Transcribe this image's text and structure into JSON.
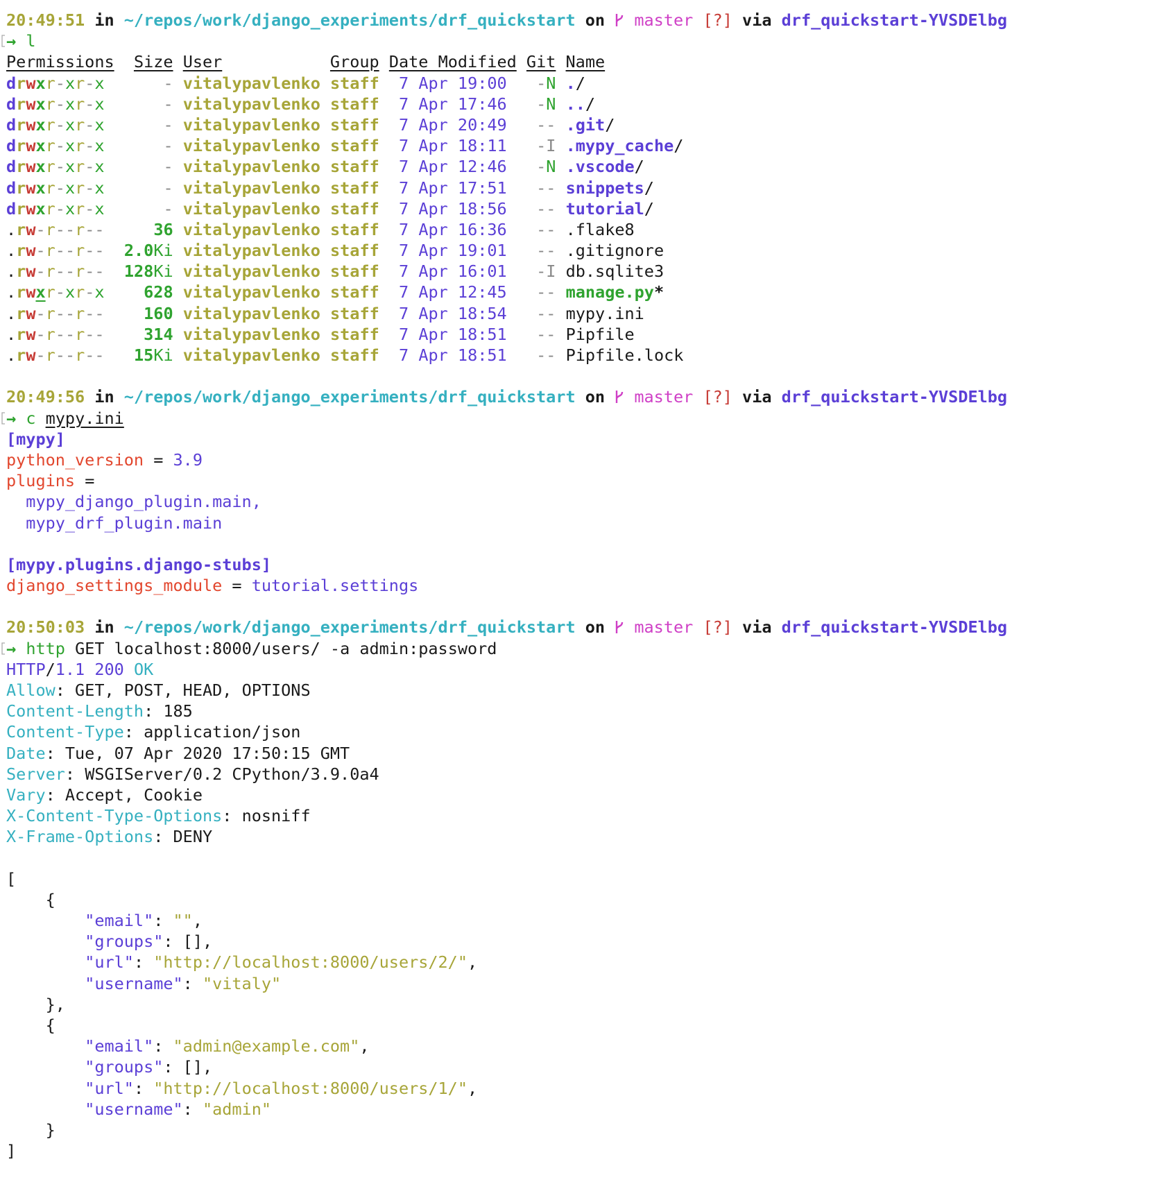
{
  "prompts": [
    {
      "time": "20:49:51",
      "in": "in",
      "path": "~/repos/work/django_experiments/drf_quickstart",
      "on": "on",
      "branch": "master",
      "status": "[?]",
      "via": "via",
      "venv": "drf_quickstart-YVSDElbg",
      "cmd": "l",
      "args": ""
    },
    {
      "time": "20:49:56",
      "in": "in",
      "path": "~/repos/work/django_experiments/drf_quickstart",
      "on": "on",
      "branch": "master",
      "status": "[?]",
      "via": "via",
      "venv": "drf_quickstart-YVSDElbg",
      "cmd": "c",
      "args": "mypy.ini"
    },
    {
      "time": "20:50:03",
      "in": "in",
      "path": "~/repos/work/django_experiments/drf_quickstart",
      "on": "on",
      "branch": "master",
      "status": "[?]",
      "via": "via",
      "venv": "drf_quickstart-YVSDElbg",
      "cmd": "http",
      "args": "GET localhost:8000/users/ -a admin:password"
    }
  ],
  "listing": {
    "headers": {
      "permissions": "Permissions",
      "size": "Size",
      "user": "User",
      "group": "Group",
      "date": "Date Modified",
      "git": "Git",
      "name": "Name"
    },
    "rows": [
      {
        "type": "d",
        "perm": "rwx",
        "rest": "r-xr-x",
        "size": "-",
        "user": "vitalypavlenko",
        "group": "staff",
        "date": "7 Apr 19:00",
        "git": "-N",
        "name": "./",
        "kind": "dir"
      },
      {
        "type": "d",
        "perm": "rwx",
        "rest": "r-xr-x",
        "size": "-",
        "user": "vitalypavlenko",
        "group": "staff",
        "date": "7 Apr 17:46",
        "git": "-N",
        "name": "../",
        "kind": "dir"
      },
      {
        "type": "d",
        "perm": "rwx",
        "rest": "r-xr-x",
        "size": "-",
        "user": "vitalypavlenko",
        "group": "staff",
        "date": "7 Apr 20:49",
        "git": "--",
        "name": ".git/",
        "kind": "dir"
      },
      {
        "type": "d",
        "perm": "rwx",
        "rest": "r-xr-x",
        "size": "-",
        "user": "vitalypavlenko",
        "group": "staff",
        "date": "7 Apr 18:11",
        "git": "-I",
        "name": ".mypy_cache/",
        "kind": "dir"
      },
      {
        "type": "d",
        "perm": "rwx",
        "rest": "r-xr-x",
        "size": "-",
        "user": "vitalypavlenko",
        "group": "staff",
        "date": "7 Apr 12:46",
        "git": "-N",
        "name": ".vscode/",
        "kind": "dir"
      },
      {
        "type": "d",
        "perm": "rwx",
        "rest": "r-xr-x",
        "size": "-",
        "user": "vitalypavlenko",
        "group": "staff",
        "date": "7 Apr 17:51",
        "git": "--",
        "name": "snippets/",
        "kind": "dir"
      },
      {
        "type": "d",
        "perm": "rwx",
        "rest": "r-xr-x",
        "size": "-",
        "user": "vitalypavlenko",
        "group": "staff",
        "date": "7 Apr 18:56",
        "git": "--",
        "name": "tutorial/",
        "kind": "dir"
      },
      {
        "type": ".",
        "perm": "rw-",
        "rest": "r--r--",
        "size": "36",
        "user": "vitalypavlenko",
        "group": "staff",
        "date": "7 Apr 16:36",
        "git": "--",
        "name": ".flake8",
        "kind": "file"
      },
      {
        "type": ".",
        "perm": "rw-",
        "rest": "r--r--",
        "size": "2.0Ki",
        "user": "vitalypavlenko",
        "group": "staff",
        "date": "7 Apr 19:01",
        "git": "--",
        "name": ".gitignore",
        "kind": "file"
      },
      {
        "type": ".",
        "perm": "rw-",
        "rest": "r--r--",
        "size": "128Ki",
        "user": "vitalypavlenko",
        "group": "staff",
        "date": "7 Apr 16:01",
        "git": "-I",
        "name": "db.sqlite3",
        "kind": "file"
      },
      {
        "type": ".",
        "perm": "rwx",
        "rest": "r-xr-x",
        "size": "628",
        "user": "vitalypavlenko",
        "group": "staff",
        "date": "7 Apr 12:45",
        "git": "--",
        "name": "manage.py*",
        "kind": "exec"
      },
      {
        "type": ".",
        "perm": "rw-",
        "rest": "r--r--",
        "size": "160",
        "user": "vitalypavlenko",
        "group": "staff",
        "date": "7 Apr 18:54",
        "git": "--",
        "name": "mypy.ini",
        "kind": "file"
      },
      {
        "type": ".",
        "perm": "rw-",
        "rest": "r--r--",
        "size": "314",
        "user": "vitalypavlenko",
        "group": "staff",
        "date": "7 Apr 18:51",
        "git": "--",
        "name": "Pipfile",
        "kind": "file"
      },
      {
        "type": ".",
        "perm": "rw-",
        "rest": "r--r--",
        "size": "15Ki",
        "user": "vitalypavlenko",
        "group": "staff",
        "date": "7 Apr 18:51",
        "git": "--",
        "name": "Pipfile.lock",
        "kind": "file"
      }
    ]
  },
  "ini": {
    "lines": [
      {
        "kind": "section",
        "text": "[mypy]"
      },
      {
        "kind": "kv",
        "key": "python_version",
        "eq": " = ",
        "value": "3.9"
      },
      {
        "kind": "kv",
        "key": "plugins",
        "eq": " =",
        "value": ""
      },
      {
        "kind": "cont",
        "text": "  mypy_django_plugin.main,"
      },
      {
        "kind": "cont",
        "text": "  mypy_drf_plugin.main"
      },
      {
        "kind": "blank"
      },
      {
        "kind": "section",
        "text": "[mypy.plugins.django-stubs]"
      },
      {
        "kind": "kv",
        "key": "django_settings_module",
        "eq": " = ",
        "value": "tutorial.settings"
      }
    ]
  },
  "http": {
    "status": {
      "proto": "HTTP",
      "slash": "/",
      "version": "1.1",
      "code": "200",
      "reason": "OK"
    },
    "headers": [
      {
        "name": "Allow",
        "value": "GET, POST, HEAD, OPTIONS"
      },
      {
        "name": "Content-Length",
        "value": "185"
      },
      {
        "name": "Content-Type",
        "value": "application/json"
      },
      {
        "name": "Date",
        "value": "Tue, 07 Apr 2020 17:50:15 GMT"
      },
      {
        "name": "Server",
        "value": "WSGIServer/0.2 CPython/3.9.0a4"
      },
      {
        "name": "Vary",
        "value": "Accept, Cookie"
      },
      {
        "name": "X-Content-Type-Options",
        "value": "nosniff"
      },
      {
        "name": "X-Frame-Options",
        "value": "DENY"
      }
    ],
    "body": [
      {
        "email": "\"\"",
        "groups": "[]",
        "url": "\"http://localhost:8000/users/2/\"",
        "username": "\"vitaly\""
      },
      {
        "email": "\"admin@example.com\"",
        "groups": "[]",
        "url": "\"http://localhost:8000/users/1/\"",
        "username": "\"admin\""
      }
    ]
  },
  "icons": {
    "arrow": "→",
    "branch": "git-branch-icon"
  },
  "colors": {
    "time": "#a7a538",
    "path": "#35b0c0",
    "branch": "#cf3fc6",
    "venv": "#5b3fd6",
    "ok": "#2fa32f",
    "error": "#c63a34"
  }
}
